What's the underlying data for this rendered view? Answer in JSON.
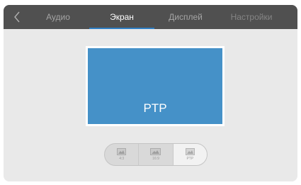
{
  "tabs": [
    {
      "label": "Аудио",
      "active": false
    },
    {
      "label": "Экран",
      "active": true
    },
    {
      "label": "Дисплей",
      "active": false
    },
    {
      "label": "Настройки",
      "active": false
    }
  ],
  "preview": {
    "label": "PTP"
  },
  "aspect_options": [
    {
      "label": "4:3",
      "selected": false
    },
    {
      "label": "16:9",
      "selected": false
    },
    {
      "label": "PTP",
      "selected": true
    }
  ],
  "colors": {
    "accent": "#2f7fc4",
    "preview_bg": "#4591c8",
    "topbar": "#505050"
  },
  "icons": {
    "back": "chevron-left-icon",
    "aspect": "image-icon"
  }
}
